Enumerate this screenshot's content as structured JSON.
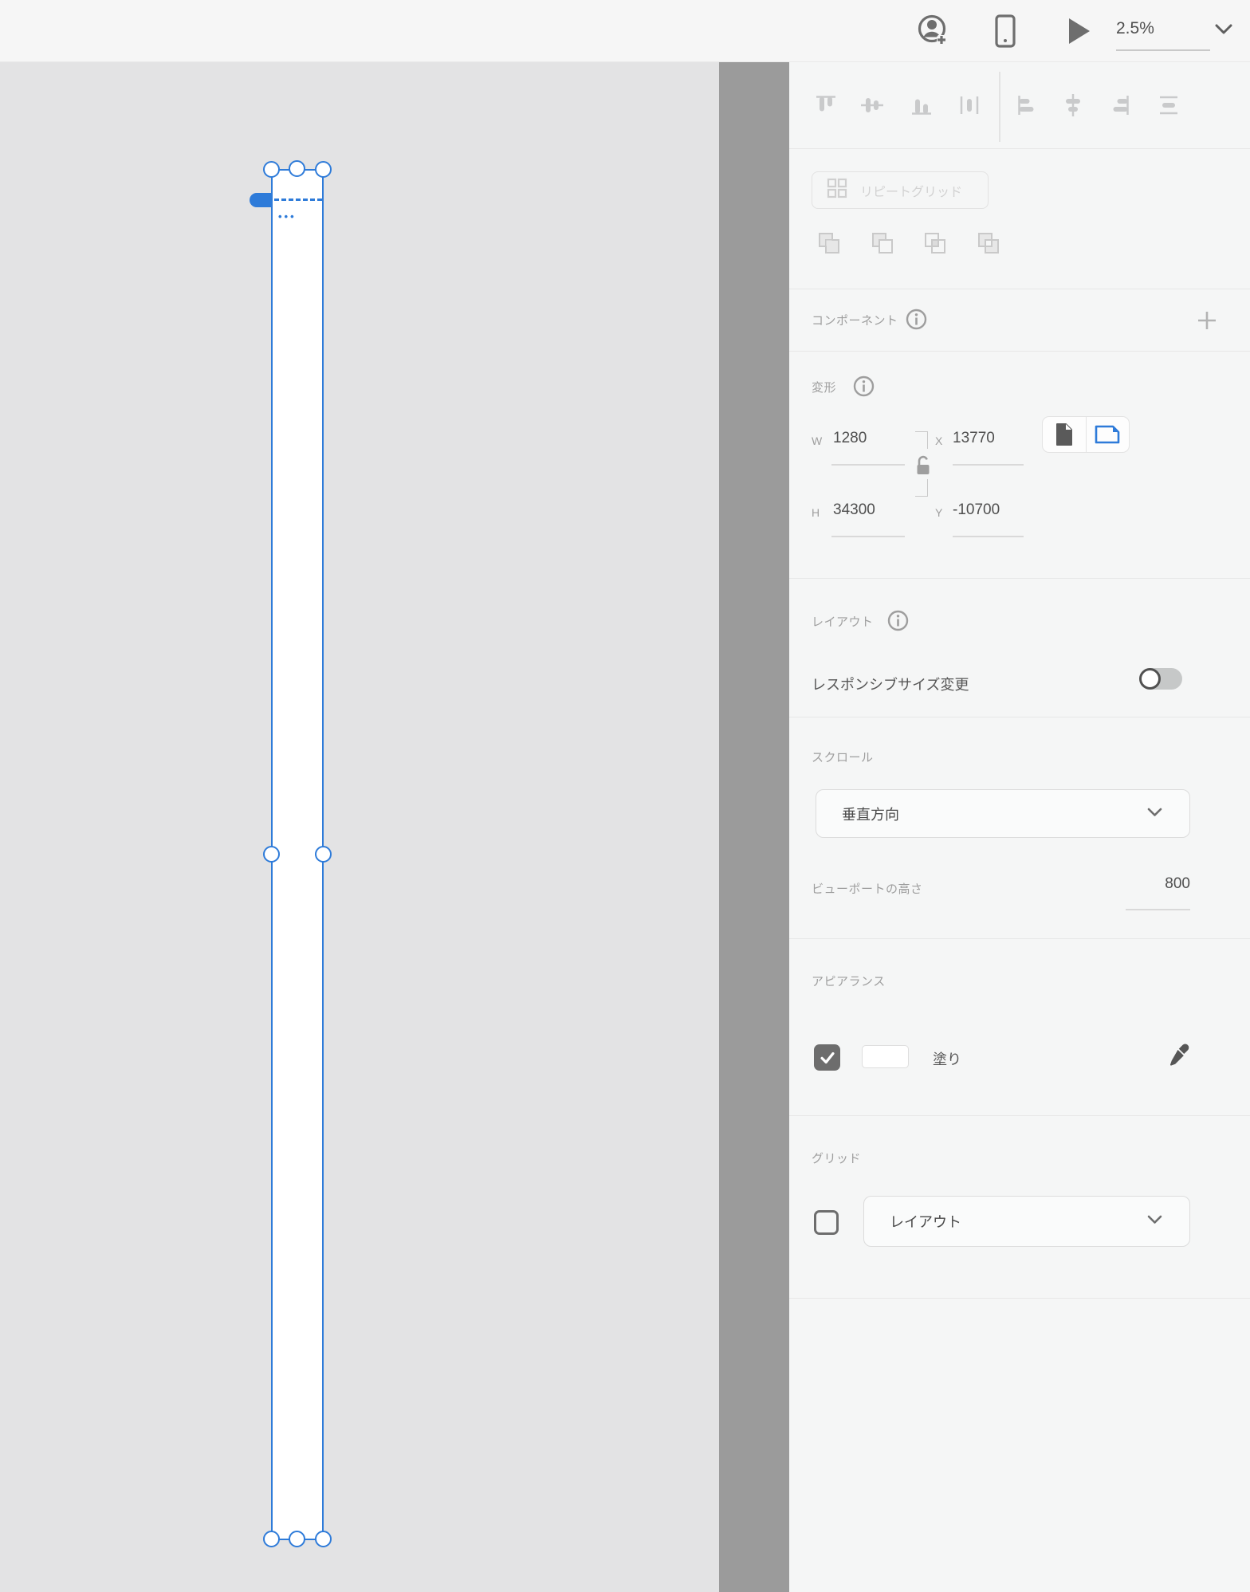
{
  "topbar": {
    "zoom_level": "2.5%",
    "icons": [
      "add-user",
      "device-preview",
      "play",
      "zoom-chevron"
    ]
  },
  "canvas": {
    "artboard": {
      "title_ellipsis": "•••",
      "selected": true,
      "selection_color": "#2e7bd9",
      "fill_color": "#ffffff"
    }
  },
  "panel": {
    "align_tools": [
      "align-top",
      "align-middle-vertical",
      "align-bottom",
      "distribute-horizontal",
      "align-left",
      "align-center-horizontal",
      "align-right",
      "distribute-vertical"
    ],
    "repeat_grid": {
      "label": "リピートグリッド",
      "enabled": false
    },
    "boolean_tools": [
      "add",
      "subtract",
      "intersect",
      "exclude-overlap"
    ],
    "component": {
      "label": "コンポーネント"
    },
    "transform": {
      "label": "変形",
      "w_label": "W",
      "w_value": "1280",
      "x_label": "X",
      "x_value": "13770",
      "h_label": "H",
      "h_value": "34300",
      "y_label": "Y",
      "y_value": "-10700",
      "lock_state": "unlocked",
      "orientation": "landscape"
    },
    "layout": {
      "label": "レイアウト",
      "responsive_label": "レスポンシブサイズ変更",
      "responsive_enabled": false
    },
    "scroll": {
      "label": "スクロール",
      "direction_value": "垂直方向",
      "viewport_label": "ビューポートの高さ",
      "viewport_value": "800"
    },
    "appearance": {
      "label": "アピアランス",
      "fill_label": "塗り",
      "fill_enabled": true,
      "fill_color": "#ffffff"
    },
    "grid": {
      "label": "グリッド",
      "type_value": "レイアウト",
      "enabled": false
    }
  },
  "colors": {
    "accent": "#2e7bd9",
    "panel_bg": "#f5f6f6",
    "canvas_bg": "#e3e3e4",
    "gutter": "#9b9b9b",
    "topbar_bg": "#f6f6f6"
  }
}
